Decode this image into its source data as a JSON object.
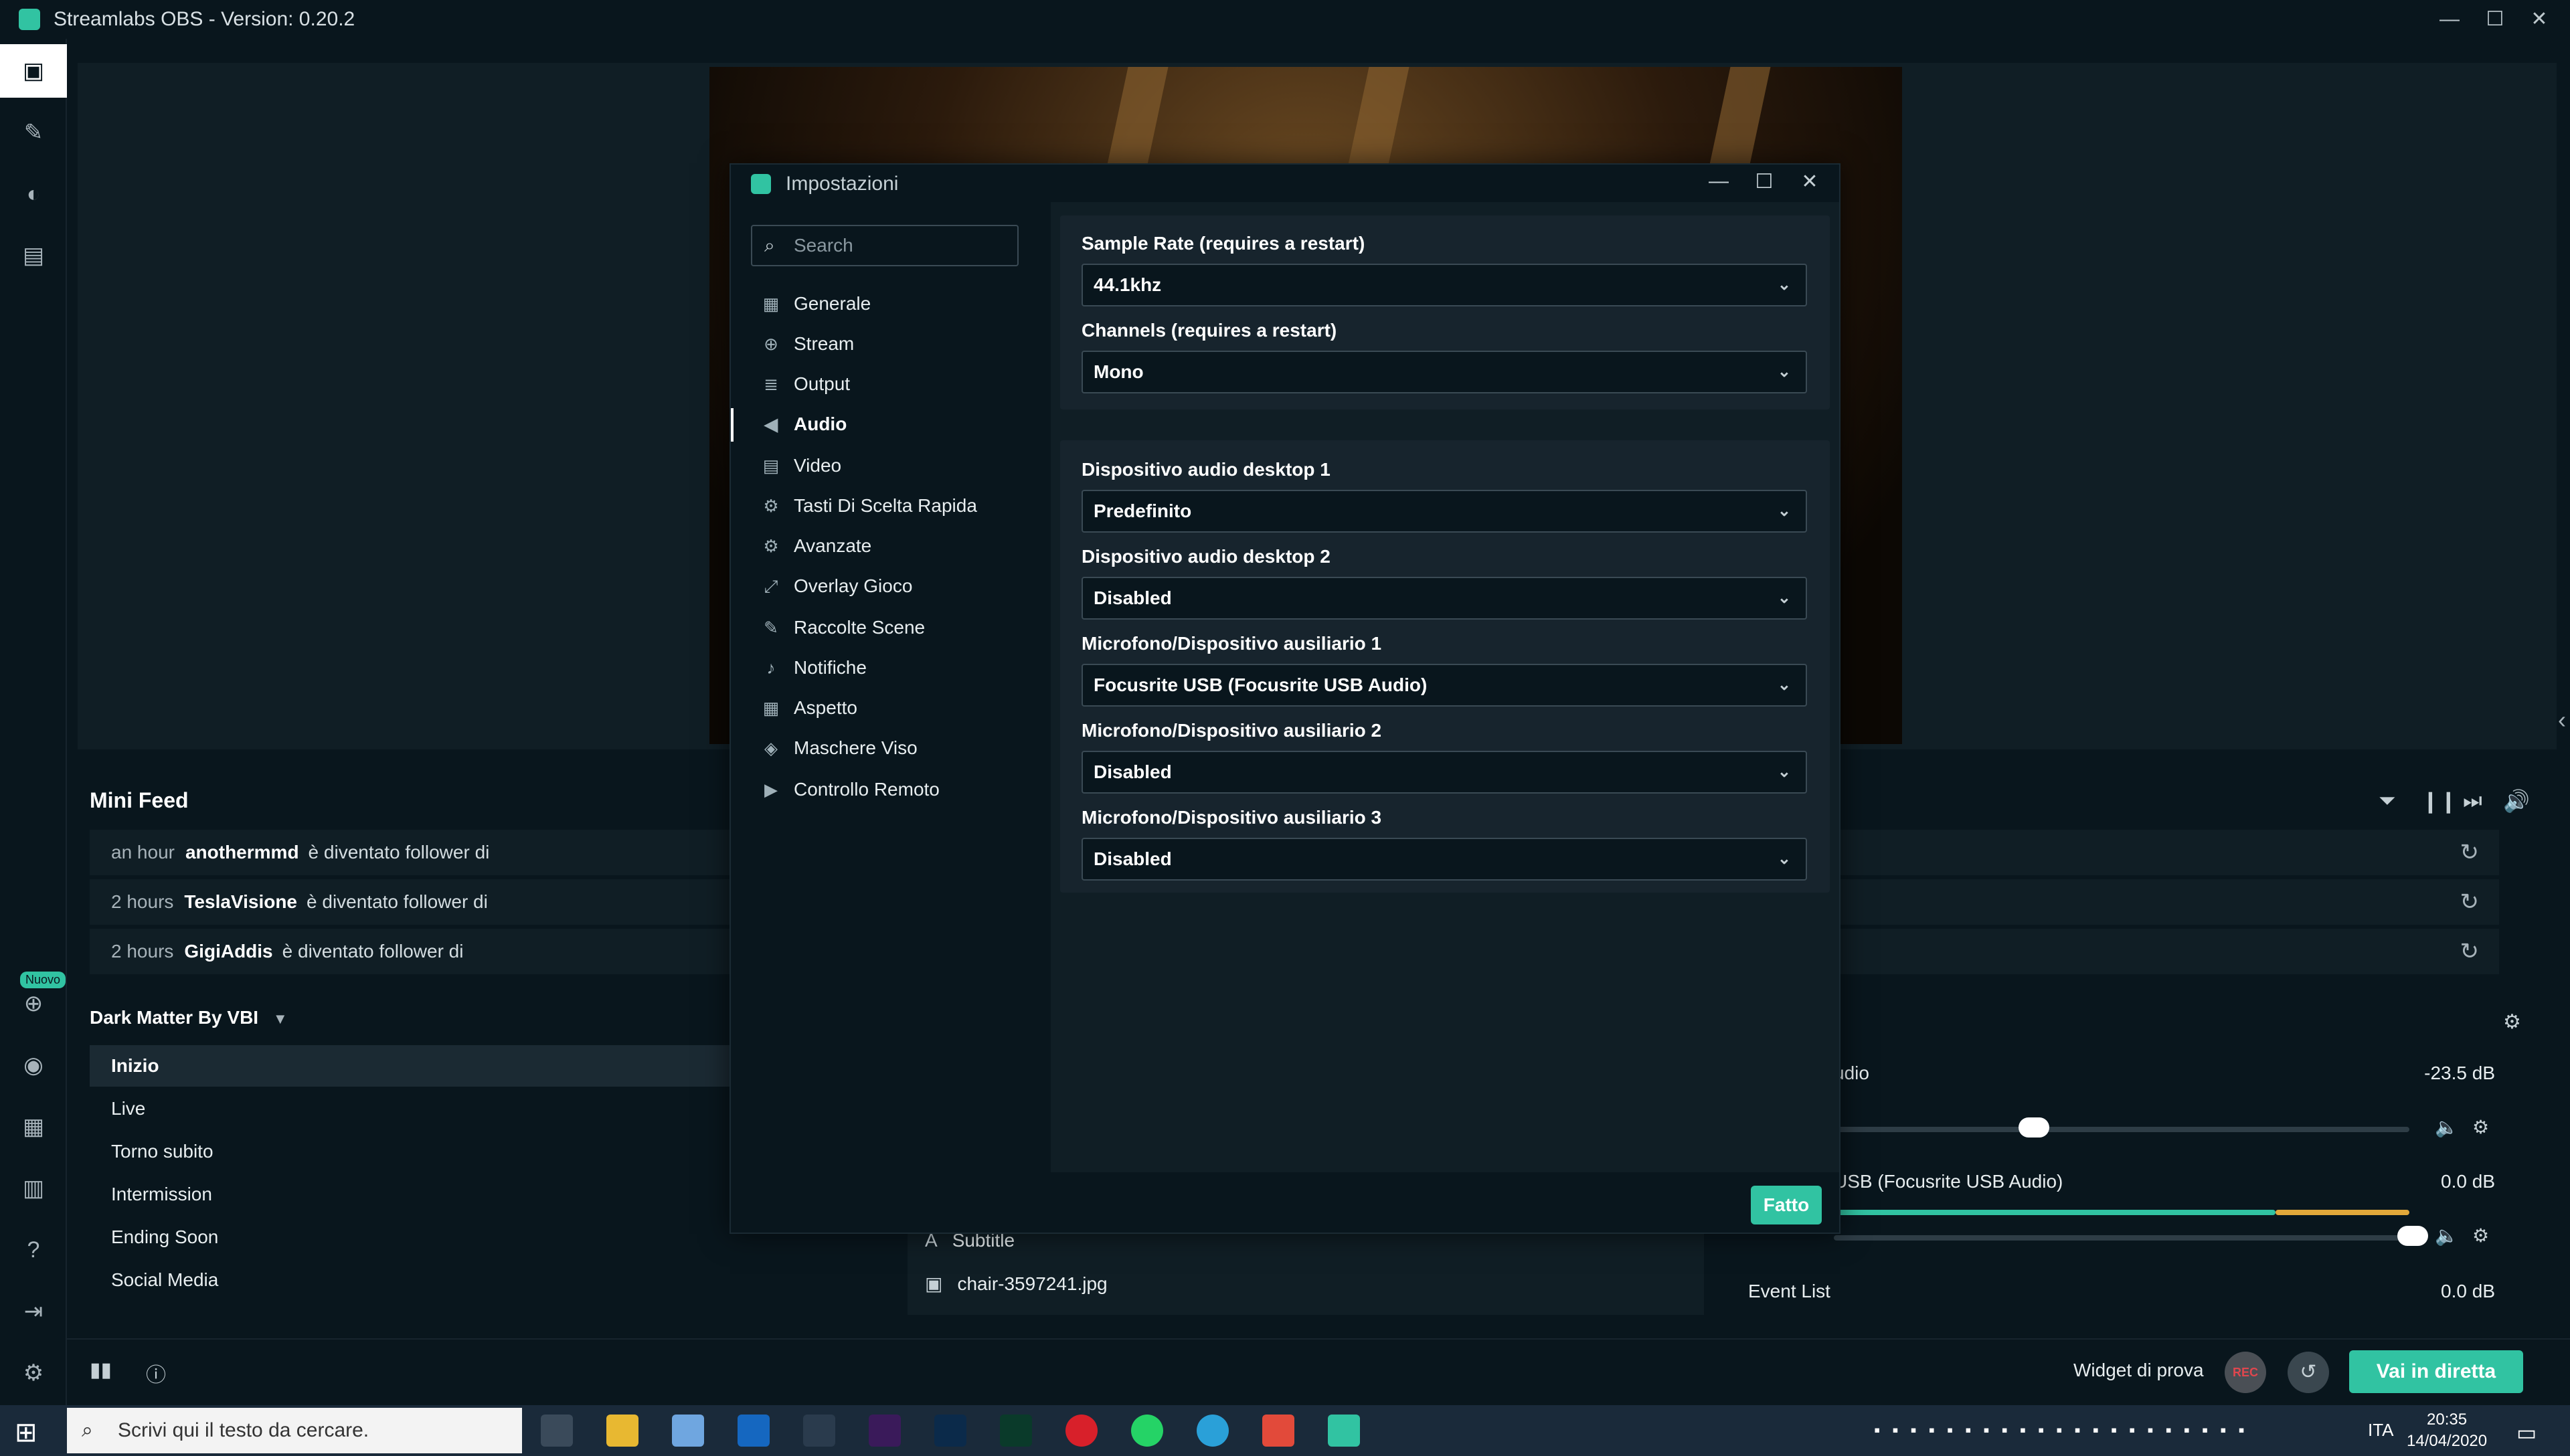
{
  "app": {
    "title": "Streamlabs OBS - Version: 0.20.2"
  },
  "window_controls": {
    "minimize": "—",
    "maximize": "☐",
    "close": "✕"
  },
  "leftnav": {
    "icons": [
      "editor-icon",
      "themes-icon",
      "chatbot-icon",
      "store-icon"
    ],
    "badge": "Nuovo"
  },
  "minifeed": {
    "title": "Mini Feed",
    "rows": [
      {
        "time": "an hour",
        "name": "anothermmd",
        "action": "è diventato follower di"
      },
      {
        "time": "2 hours",
        "name": "TeslaVisione",
        "action": "è diventato follower di"
      },
      {
        "time": "2 hours",
        "name": "GigiAddis",
        "action": "è diventato follower di"
      }
    ]
  },
  "scenes": {
    "collection": "Dark Matter By VBI",
    "items": [
      "Inizio",
      "Live",
      "Torno subito",
      "Intermission",
      "Ending Soon",
      "Social Media"
    ],
    "active": "Inizio"
  },
  "sources": {
    "items": [
      {
        "icon": "text-icon",
        "label": "Subtitle"
      },
      {
        "icon": "image-icon",
        "label": "chair-3597241.jpg"
      }
    ]
  },
  "mixer": {
    "channels": [
      {
        "label": "udio",
        "db": "-23.5 dB",
        "level": 0.5
      },
      {
        "label": "USB (Focusrite USB Audio)",
        "db": "0.0 dB",
        "level": 0.97
      },
      {
        "label": "Event List",
        "db": "0.0 dB",
        "level": 0
      }
    ]
  },
  "footer": {
    "widget_label": "Widget di prova",
    "rec_label": "REC",
    "go_live": "Vai in diretta"
  },
  "taskbar": {
    "search_placeholder": "Scrivi qui il testo da cercare.",
    "lang": "ITA",
    "time": "20:35",
    "date": "14/04/2020"
  },
  "settings": {
    "title": "Impostazioni",
    "search_placeholder": "Search",
    "nav": [
      {
        "icon": "grid-icon",
        "label": "Generale"
      },
      {
        "icon": "globe-icon",
        "label": "Stream"
      },
      {
        "icon": "database-icon",
        "label": "Output"
      },
      {
        "icon": "speaker-icon",
        "label": "Audio"
      },
      {
        "icon": "film-icon",
        "label": "Video"
      },
      {
        "icon": "gear-icon",
        "label": "Tasti Di Scelta Rapida"
      },
      {
        "icon": "gears-icon",
        "label": "Avanzate"
      },
      {
        "icon": "expand-icon",
        "label": "Overlay Gioco"
      },
      {
        "icon": "palette-icon",
        "label": "Raccolte Scene"
      },
      {
        "icon": "bell-icon",
        "label": "Notifiche"
      },
      {
        "icon": "puzzle-icon",
        "label": "Aspetto"
      },
      {
        "icon": "mask-icon",
        "label": "Maschere Viso"
      },
      {
        "icon": "play-circle-icon",
        "label": "Controllo Remoto"
      }
    ],
    "active": "Audio",
    "general_card": [
      {
        "label": "Sample Rate (requires a restart)",
        "value": "44.1khz"
      },
      {
        "label": "Channels (requires a restart)",
        "value": "Mono"
      }
    ],
    "devices_card": [
      {
        "label": "Dispositivo audio desktop 1",
        "value": "Predefinito"
      },
      {
        "label": "Dispositivo audio desktop 2",
        "value": "Disabled"
      },
      {
        "label": "Microfono/Dispositivo ausiliario 1",
        "value": "Focusrite USB (Focusrite USB Audio)"
      },
      {
        "label": "Microfono/Dispositivo ausiliario 2",
        "value": "Disabled"
      },
      {
        "label": "Microfono/Dispositivo ausiliario 3",
        "value": "Disabled"
      }
    ],
    "done_button": "Fatto"
  },
  "colors": {
    "accent": "#31c3a2",
    "background": "#09161d",
    "panel": "#101e25",
    "card": "#17242d"
  }
}
